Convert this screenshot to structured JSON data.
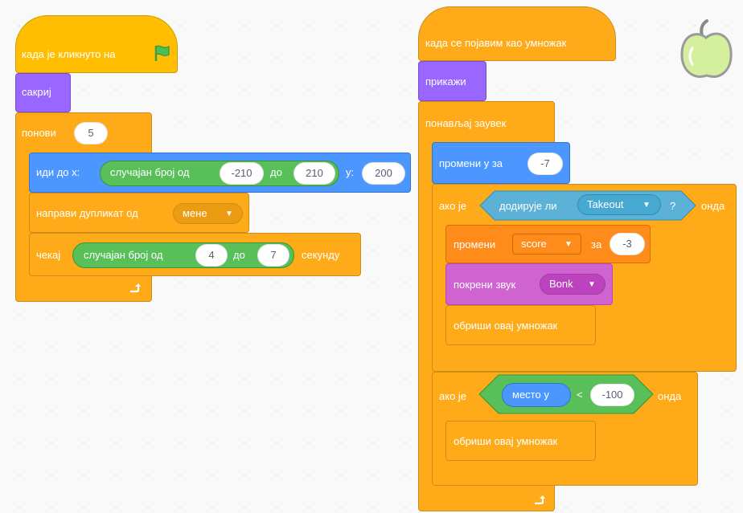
{
  "left_script": {
    "hat_label": "када је кликнуто на",
    "flag_icon": "green-flag-icon",
    "hide_label": "сакриј",
    "repeat_label": "понови",
    "repeat_count": "5",
    "goto_label": "иди до x:",
    "random1_label": "случајан број од",
    "random1_from": "-210",
    "random1_to_label": "до",
    "random1_to": "210",
    "goto_y_label": "y:",
    "goto_y": "200",
    "clone_label": "направи дупликат од",
    "clone_target": "мене",
    "wait_label": "чекај",
    "random2_label": "случајан број од",
    "random2_from": "4",
    "random2_to_label": "до",
    "random2_to": "7",
    "wait_unit": "секунду",
    "loop_arrow_icon": "loop-arrow-icon"
  },
  "right_script": {
    "hat_label": "када се појавим као умножак",
    "show_label": "прикажи",
    "forever_label": "понављај заувек",
    "change_y_label": "промени y за",
    "change_y_value": "-7",
    "if1_label": "ако је",
    "touching_label": "додирује ли",
    "touching_target": "Takeout",
    "touching_q": "?",
    "if1_then": "онда",
    "change_var_label": "промени",
    "change_var_name": "score",
    "change_var_by": "за",
    "change_var_value": "-3",
    "sound_label": "покрени звук",
    "sound_name": "Bonk",
    "delete_clone1": "обриши овај умножак",
    "if2_label": "ако је",
    "lt_left": "место y",
    "lt_op": "<",
    "lt_right": "-100",
    "if2_then": "онда",
    "delete_clone2": "обриши овај умножак",
    "loop_arrow_icon": "loop-arrow-icon"
  },
  "sprite_icon": "apple-sprite-icon",
  "colors": {
    "events": "#ffbf00",
    "looks": "#9966ff",
    "control": "#ffab19",
    "motion": "#4c97ff",
    "variables": "#ff8c1a",
    "sound": "#cf63cf",
    "operators": "#59c059",
    "sensing": "#5cb1d6"
  }
}
